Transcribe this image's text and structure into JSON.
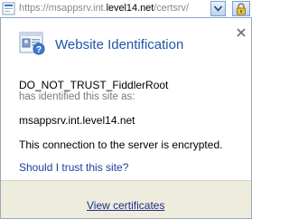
{
  "address_bar": {
    "url_prefix": "https://msappsrv.int.",
    "url_domain": "level14.net",
    "url_suffix": "/certsrv/",
    "lock_icon": "lock-icon",
    "dropdown_icon": "chevron-down-icon"
  },
  "popup": {
    "title": "Website Identification",
    "title_color": "#1f57a8",
    "owner": "DO_NOT_TRUST_FiddlerRoot",
    "identified_text": "has identified this site as:",
    "site": "msappsrv.int.level14.net",
    "encryption_text": "This connection to the server is encrypted.",
    "trust_link": "Should I trust this site?",
    "footer_link": "View certificates",
    "footer_color": "#eeeddd",
    "close_icon": "close-icon",
    "identity_icon": "identity-card-icon"
  }
}
